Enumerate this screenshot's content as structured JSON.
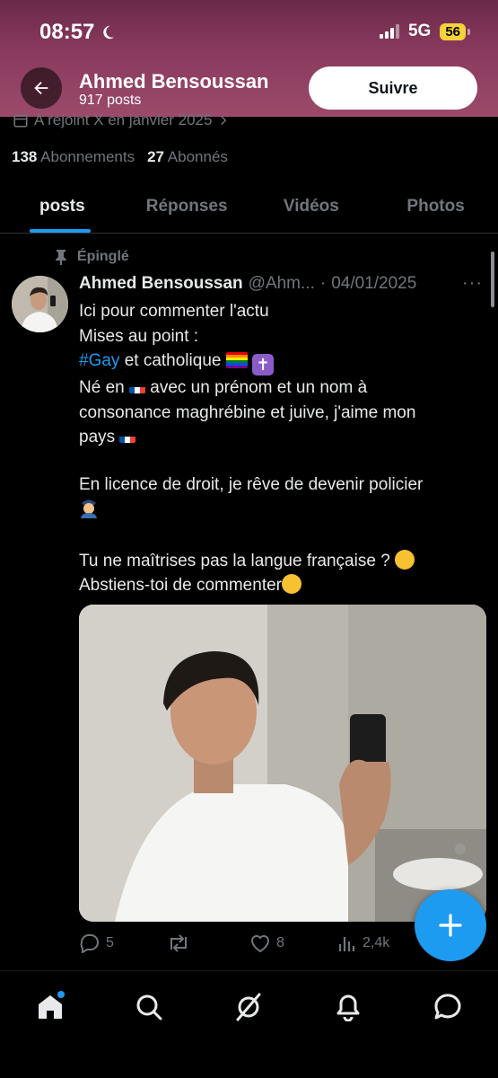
{
  "status_bar": {
    "time": "08:57",
    "network": "5G",
    "battery": "56"
  },
  "header": {
    "name": "Ahmed Bensoussan",
    "posts_count": "917 posts",
    "follow_label": "Suivre"
  },
  "profile": {
    "joined": "A rejoint X en janvier 2025",
    "following_count": "138",
    "following_label": "Abonnements",
    "followers_count": "27",
    "followers_label": "Abonnés"
  },
  "tabs": [
    {
      "label": "posts",
      "active": true
    },
    {
      "label": "Réponses",
      "active": false
    },
    {
      "label": "Vidéos",
      "active": false
    },
    {
      "label": "Photos",
      "active": false
    }
  ],
  "post": {
    "pinned_label": "Épinglé",
    "author": "Ahmed Bensoussan",
    "handle": "@Ahm...",
    "separator": "·",
    "date": "04/01/2025",
    "more": "···",
    "lines": {
      "l1": "Ici pour commenter l'actu",
      "l2": "Mises au point :",
      "hashtag": "#Gay",
      "l3_rest": " et catholique ",
      "l4a": "Né en ",
      "l4b": " avec un prénom et un nom à",
      "l5": "consonance maghrébine et juive, j'aime mon",
      "l6": "pays ",
      "l7": "En licence de droit, je rêve de devenir policier",
      "l8": "Tu ne maîtrises pas la langue française ? ",
      "l9": "Abstiens-toi de commenter"
    },
    "stats": {
      "replies": "5",
      "reposts": "",
      "likes": "8",
      "views": "2,4k"
    }
  },
  "icons": {
    "back": "arrow-left-icon",
    "calendar": "calendar-icon",
    "pin": "pin-icon",
    "reply": "reply-icon",
    "repost": "repost-icon",
    "like": "heart-icon",
    "views": "views-icon",
    "fab": "plus-icon",
    "home": "home-icon",
    "search": "search-icon",
    "grok": "grok-icon",
    "notifications": "bell-icon",
    "messages": "message-icon"
  },
  "colors": {
    "accent": "#1d9bf0",
    "muted": "#71767b",
    "header_gradient": "#8a3a5e"
  }
}
